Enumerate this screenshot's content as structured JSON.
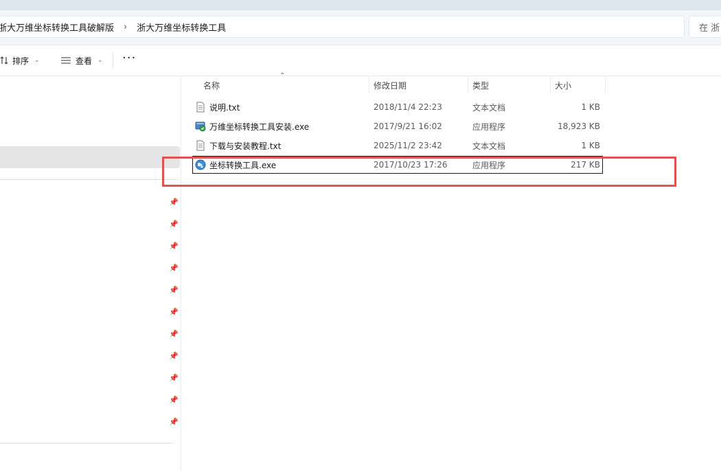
{
  "address": {
    "crumbs": [
      "浙大万维坐标转换工具破解版",
      "浙大万维坐标转换工具"
    ],
    "separator": "›",
    "search_placeholder": "在 浙"
  },
  "toolbar": {
    "sort_label": "排序",
    "view_label": "查看",
    "more_label": "···"
  },
  "columns": {
    "name": "名称",
    "modified": "修改日期",
    "type": "类型",
    "size": "大小"
  },
  "files": [
    {
      "name": "说明.txt",
      "modified": "2018/11/4 22:23",
      "type": "文本文档",
      "size": "1 KB",
      "icon": "text-file-icon"
    },
    {
      "name": "万维坐标转换工具安装.exe",
      "modified": "2017/9/21 16:02",
      "type": "应用程序",
      "size": "18,923 KB",
      "icon": "installer-icon"
    },
    {
      "name": "下载与安装教程.txt",
      "modified": "2025/11/2 23:42",
      "type": "文本文档",
      "size": "1 KB",
      "icon": "text-file-icon"
    },
    {
      "name": "坐标转换工具.exe",
      "modified": "2017/10/23 17:26",
      "type": "应用程序",
      "size": "217 KB",
      "icon": "globe-app-icon"
    }
  ],
  "colors": {
    "highlight": "#e25252",
    "selected_nav": "#e5e5e5"
  }
}
